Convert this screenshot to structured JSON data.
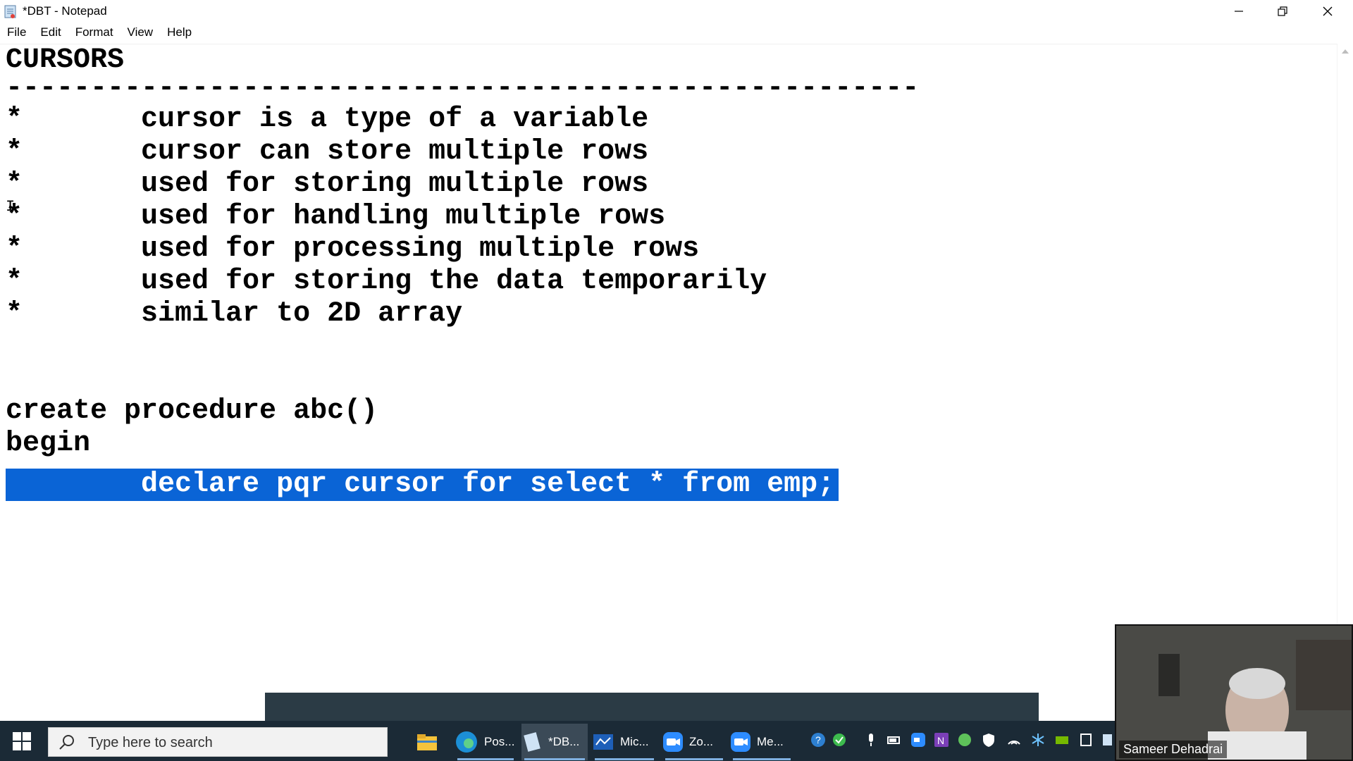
{
  "window": {
    "title": "*DBT - Notepad",
    "menu": [
      "File",
      "Edit",
      "Format",
      "View",
      "Help"
    ]
  },
  "editor": {
    "lines": [
      "CURSORS",
      "------------------------------------------------------",
      "*       cursor is a type of a variable",
      "*       cursor can store multiple rows",
      "*       used for storing multiple rows",
      "*       used for handling multiple rows",
      "*       used for processing multiple rows",
      "*       used for storing the data temporarily",
      "*       similar to 2D array",
      "",
      "",
      "create procedure abc()",
      "begin",
      "        declare pqr cursor for select * from emp;"
    ],
    "selected_line_index": 13
  },
  "taskbar": {
    "search_placeholder": "Type here to search",
    "apps": [
      {
        "label": "Pos...",
        "icon": "edge-icon"
      },
      {
        "label": "*DB...",
        "icon": "notepad-icon"
      },
      {
        "label": "Mic...",
        "icon": "whiteboard-icon"
      },
      {
        "label": "Zo...",
        "icon": "zoom-icon"
      },
      {
        "label": "Me...",
        "icon": "zoom-meeting-icon"
      }
    ]
  },
  "webcam": {
    "name": "Sameer Dehadrai"
  },
  "colors": {
    "selection": "#0a64d6",
    "taskbar": "#1b2a36"
  }
}
